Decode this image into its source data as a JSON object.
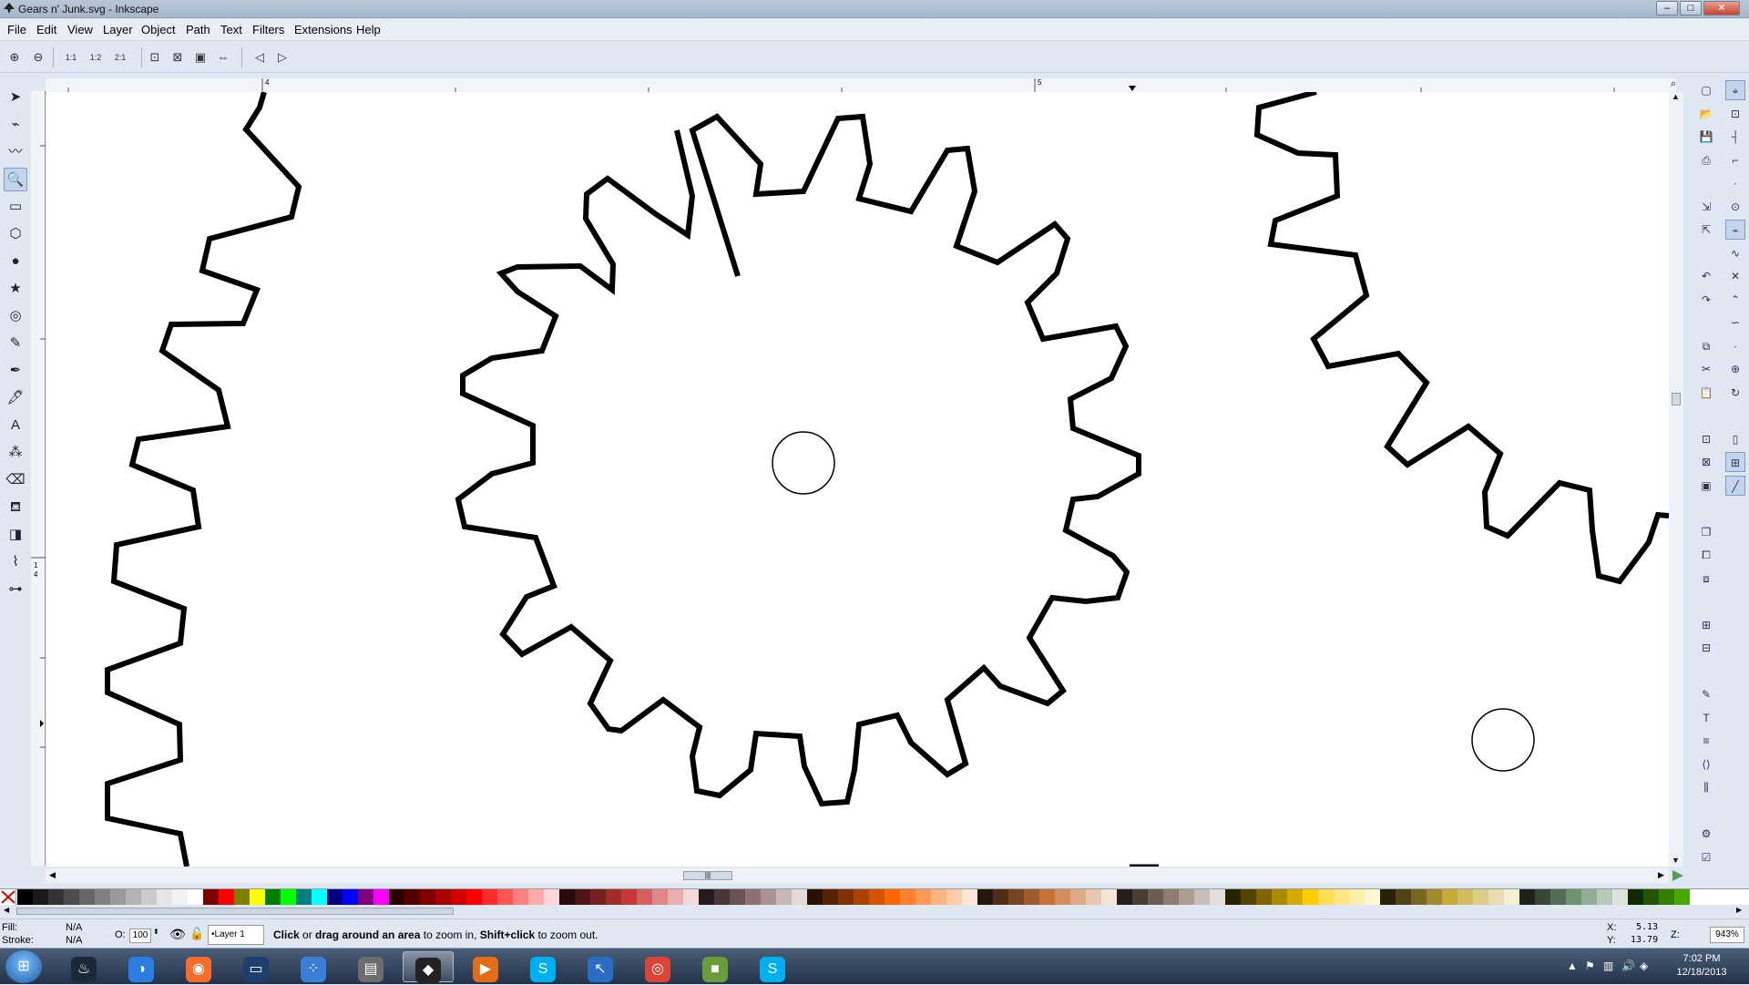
{
  "window": {
    "title": "Gears n' Junk.svg - Inkscape",
    "minimize": "–",
    "maximize": "□",
    "close": "✕"
  },
  "menu": [
    "File",
    "Edit",
    "View",
    "Layer",
    "Object",
    "Path",
    "Text",
    "Filters",
    "Extensions",
    "Help"
  ],
  "zoom_toolbar": {
    "icons": [
      "zoom-in-icon",
      "zoom-out-icon",
      "zoom-1-1-icon",
      "zoom-1-2-icon",
      "zoom-2-1-icon",
      "zoom-selection-icon",
      "zoom-drawing-icon",
      "zoom-page-icon",
      "zoom-page-width-icon",
      "zoom-previous-icon",
      "zoom-next-icon"
    ],
    "glyphs": [
      "⊕",
      "⊖",
      "1:1",
      "1:2",
      "2:1",
      "⊡",
      "⊠",
      "▣",
      "⇔",
      "◁",
      "▷"
    ]
  },
  "tools": [
    {
      "name": "selector-tool",
      "glyph": "➤"
    },
    {
      "name": "node-tool",
      "glyph": "⌁"
    },
    {
      "name": "tweak-tool",
      "glyph": "〰"
    },
    {
      "name": "zoom-tool",
      "glyph": "🔍"
    },
    {
      "name": "rectangle-tool",
      "glyph": "▭"
    },
    {
      "name": "3d-box-tool",
      "glyph": "⬡"
    },
    {
      "name": "ellipse-tool",
      "glyph": "●"
    },
    {
      "name": "star-tool",
      "glyph": "★"
    },
    {
      "name": "spiral-tool",
      "glyph": "◎"
    },
    {
      "name": "pencil-tool",
      "glyph": "✎"
    },
    {
      "name": "pen-tool",
      "glyph": "✒"
    },
    {
      "name": "calligraphy-tool",
      "glyph": "🖋"
    },
    {
      "name": "text-tool",
      "glyph": "A"
    },
    {
      "name": "spray-tool",
      "glyph": "⁂"
    },
    {
      "name": "eraser-tool",
      "glyph": "⌫"
    },
    {
      "name": "paint-bucket-tool",
      "glyph": "⛾"
    },
    {
      "name": "gradient-tool",
      "glyph": "◨"
    },
    {
      "name": "dropper-tool",
      "glyph": "⌇"
    },
    {
      "name": "connector-tool",
      "glyph": "⊶"
    }
  ],
  "ruler": {
    "h_labels": [
      "4",
      "5"
    ],
    "v_labels": [
      "1",
      "4"
    ]
  },
  "commands_right": [
    "new-document-icon",
    "open-icon",
    "save-icon",
    "print-icon",
    "import-icon",
    "export-icon",
    "undo-icon",
    "redo-icon",
    "copy-icon",
    "cut-icon",
    "paste-icon",
    "zoom-selection-icon",
    "zoom-drawing-icon",
    "zoom-page-icon",
    "duplicate-icon",
    "clone-icon",
    "unlink-clone-icon",
    "group-icon",
    "ungroup-icon",
    "fill-stroke-icon",
    "text-font-icon",
    "layers-icon",
    "xml-editor-icon",
    "align-icon",
    "preferences-icon",
    "document-properties-icon"
  ],
  "snap_right": [
    "snap-toggle-icon",
    "snap-bbox-icon",
    "snap-bbox-edge-icon",
    "snap-bbox-corner-icon",
    "snap-bbox-midpoint-icon",
    "snap-bbox-center-icon",
    "snap-nodes-icon",
    "snap-path-icon",
    "snap-intersection-icon",
    "snap-cusp-icon",
    "snap-smooth-icon",
    "snap-midpoint-icon",
    "snap-center-icon",
    "snap-rotation-icon",
    "snap-page-icon",
    "snap-grid-icon",
    "snap-guide-icon"
  ],
  "palette": [
    "#000000",
    "#1a1a1a",
    "#333333",
    "#4d4d4d",
    "#666666",
    "#808080",
    "#999999",
    "#b3b3b3",
    "#cccccc",
    "#e6e6e6",
    "#f2f2f2",
    "#ffffff",
    "#800000",
    "#ff0000",
    "#808000",
    "#ffff00",
    "#008000",
    "#00ff00",
    "#008080",
    "#00ffff",
    "#000080",
    "#0000ff",
    "#800080",
    "#ff00ff",
    "#2b0000",
    "#550000",
    "#800000",
    "#aa0000",
    "#d40000",
    "#ff0000",
    "#ff2a2a",
    "#ff5555",
    "#ff8080",
    "#ffaaaa",
    "#ffd5d5",
    "#280b0b",
    "#501616",
    "#782121",
    "#a02c2c",
    "#c83737",
    "#d35f5f",
    "#de8787",
    "#e9afaf",
    "#f4d7d7",
    "#241c1c",
    "#483737",
    "#6c5353",
    "#916f6f",
    "#ac9393",
    "#c8b7b7",
    "#e3dbdb",
    "#2b1100",
    "#552200",
    "#803300",
    "#aa4400",
    "#d45500",
    "#ff6600",
    "#ff7f2a",
    "#ff9955",
    "#ffb380",
    "#ffccaa",
    "#ffe6d5",
    "#28170b",
    "#502d16",
    "#784421",
    "#a05a2c",
    "#c87137",
    "#d38d5f",
    "#deaa87",
    "#e9c6af",
    "#f4e3d7",
    "#241f1c",
    "#483e37",
    "#6c5d53",
    "#917c6f",
    "#ac9d93",
    "#c8beb7",
    "#e3dedb",
    "#2b2200",
    "#554400",
    "#806600",
    "#aa8800",
    "#d4aa00",
    "#ffcc00",
    "#ffdd55",
    "#ffe680",
    "#ffeeaa",
    "#fff6d5",
    "#28220b",
    "#504416",
    "#786721",
    "#a0892c",
    "#c8ab37",
    "#d3bc5f",
    "#decd87",
    "#e9ddaf",
    "#f4eed7",
    "#1c241c",
    "#374837",
    "#536c53",
    "#6f916f",
    "#93ac93",
    "#b7c8b7",
    "#dbe3db",
    "#112b00",
    "#225500",
    "#338000",
    "#44aa00"
  ],
  "status": {
    "fill_label": "Fill:",
    "fill_value": "N/A",
    "stroke_label": "Stroke:",
    "stroke_value": "N/A",
    "opacity_label": "O:",
    "opacity_value": "100",
    "layer": "•Layer 1",
    "message_b1": "Click",
    "message_t1": " or ",
    "message_b2": "drag around an area",
    "message_t2": " to zoom in, ",
    "message_b3": "Shift+click",
    "message_t3": " to zoom out.",
    "x_label": "X:",
    "x_value": "5.13",
    "y_label": "Y:",
    "y_value": "13.79",
    "z_label": "Z:",
    "zoom": "943%"
  },
  "taskbar": {
    "apps": [
      {
        "name": "steam-icon",
        "glyph": "♨"
      },
      {
        "name": "uplay-icon",
        "glyph": "◑"
      },
      {
        "name": "origin-icon",
        "glyph": "◉"
      },
      {
        "name": "window-icon",
        "glyph": "▭"
      },
      {
        "name": "people-icon",
        "glyph": "⁘"
      },
      {
        "name": "file-manager-icon",
        "glyph": "▤"
      },
      {
        "name": "inkscape-taskbar-icon",
        "glyph": "◆"
      },
      {
        "name": "media-player-icon",
        "glyph": "▶"
      },
      {
        "name": "skype-icon",
        "glyph": "S"
      },
      {
        "name": "cursor-app-icon",
        "glyph": "↖"
      },
      {
        "name": "chrome-icon",
        "glyph": "◎"
      },
      {
        "name": "minecraft-icon",
        "glyph": "■"
      },
      {
        "name": "skype-2-icon",
        "glyph": "S"
      }
    ],
    "time": "7:02 PM",
    "date": "12/18/2013"
  }
}
